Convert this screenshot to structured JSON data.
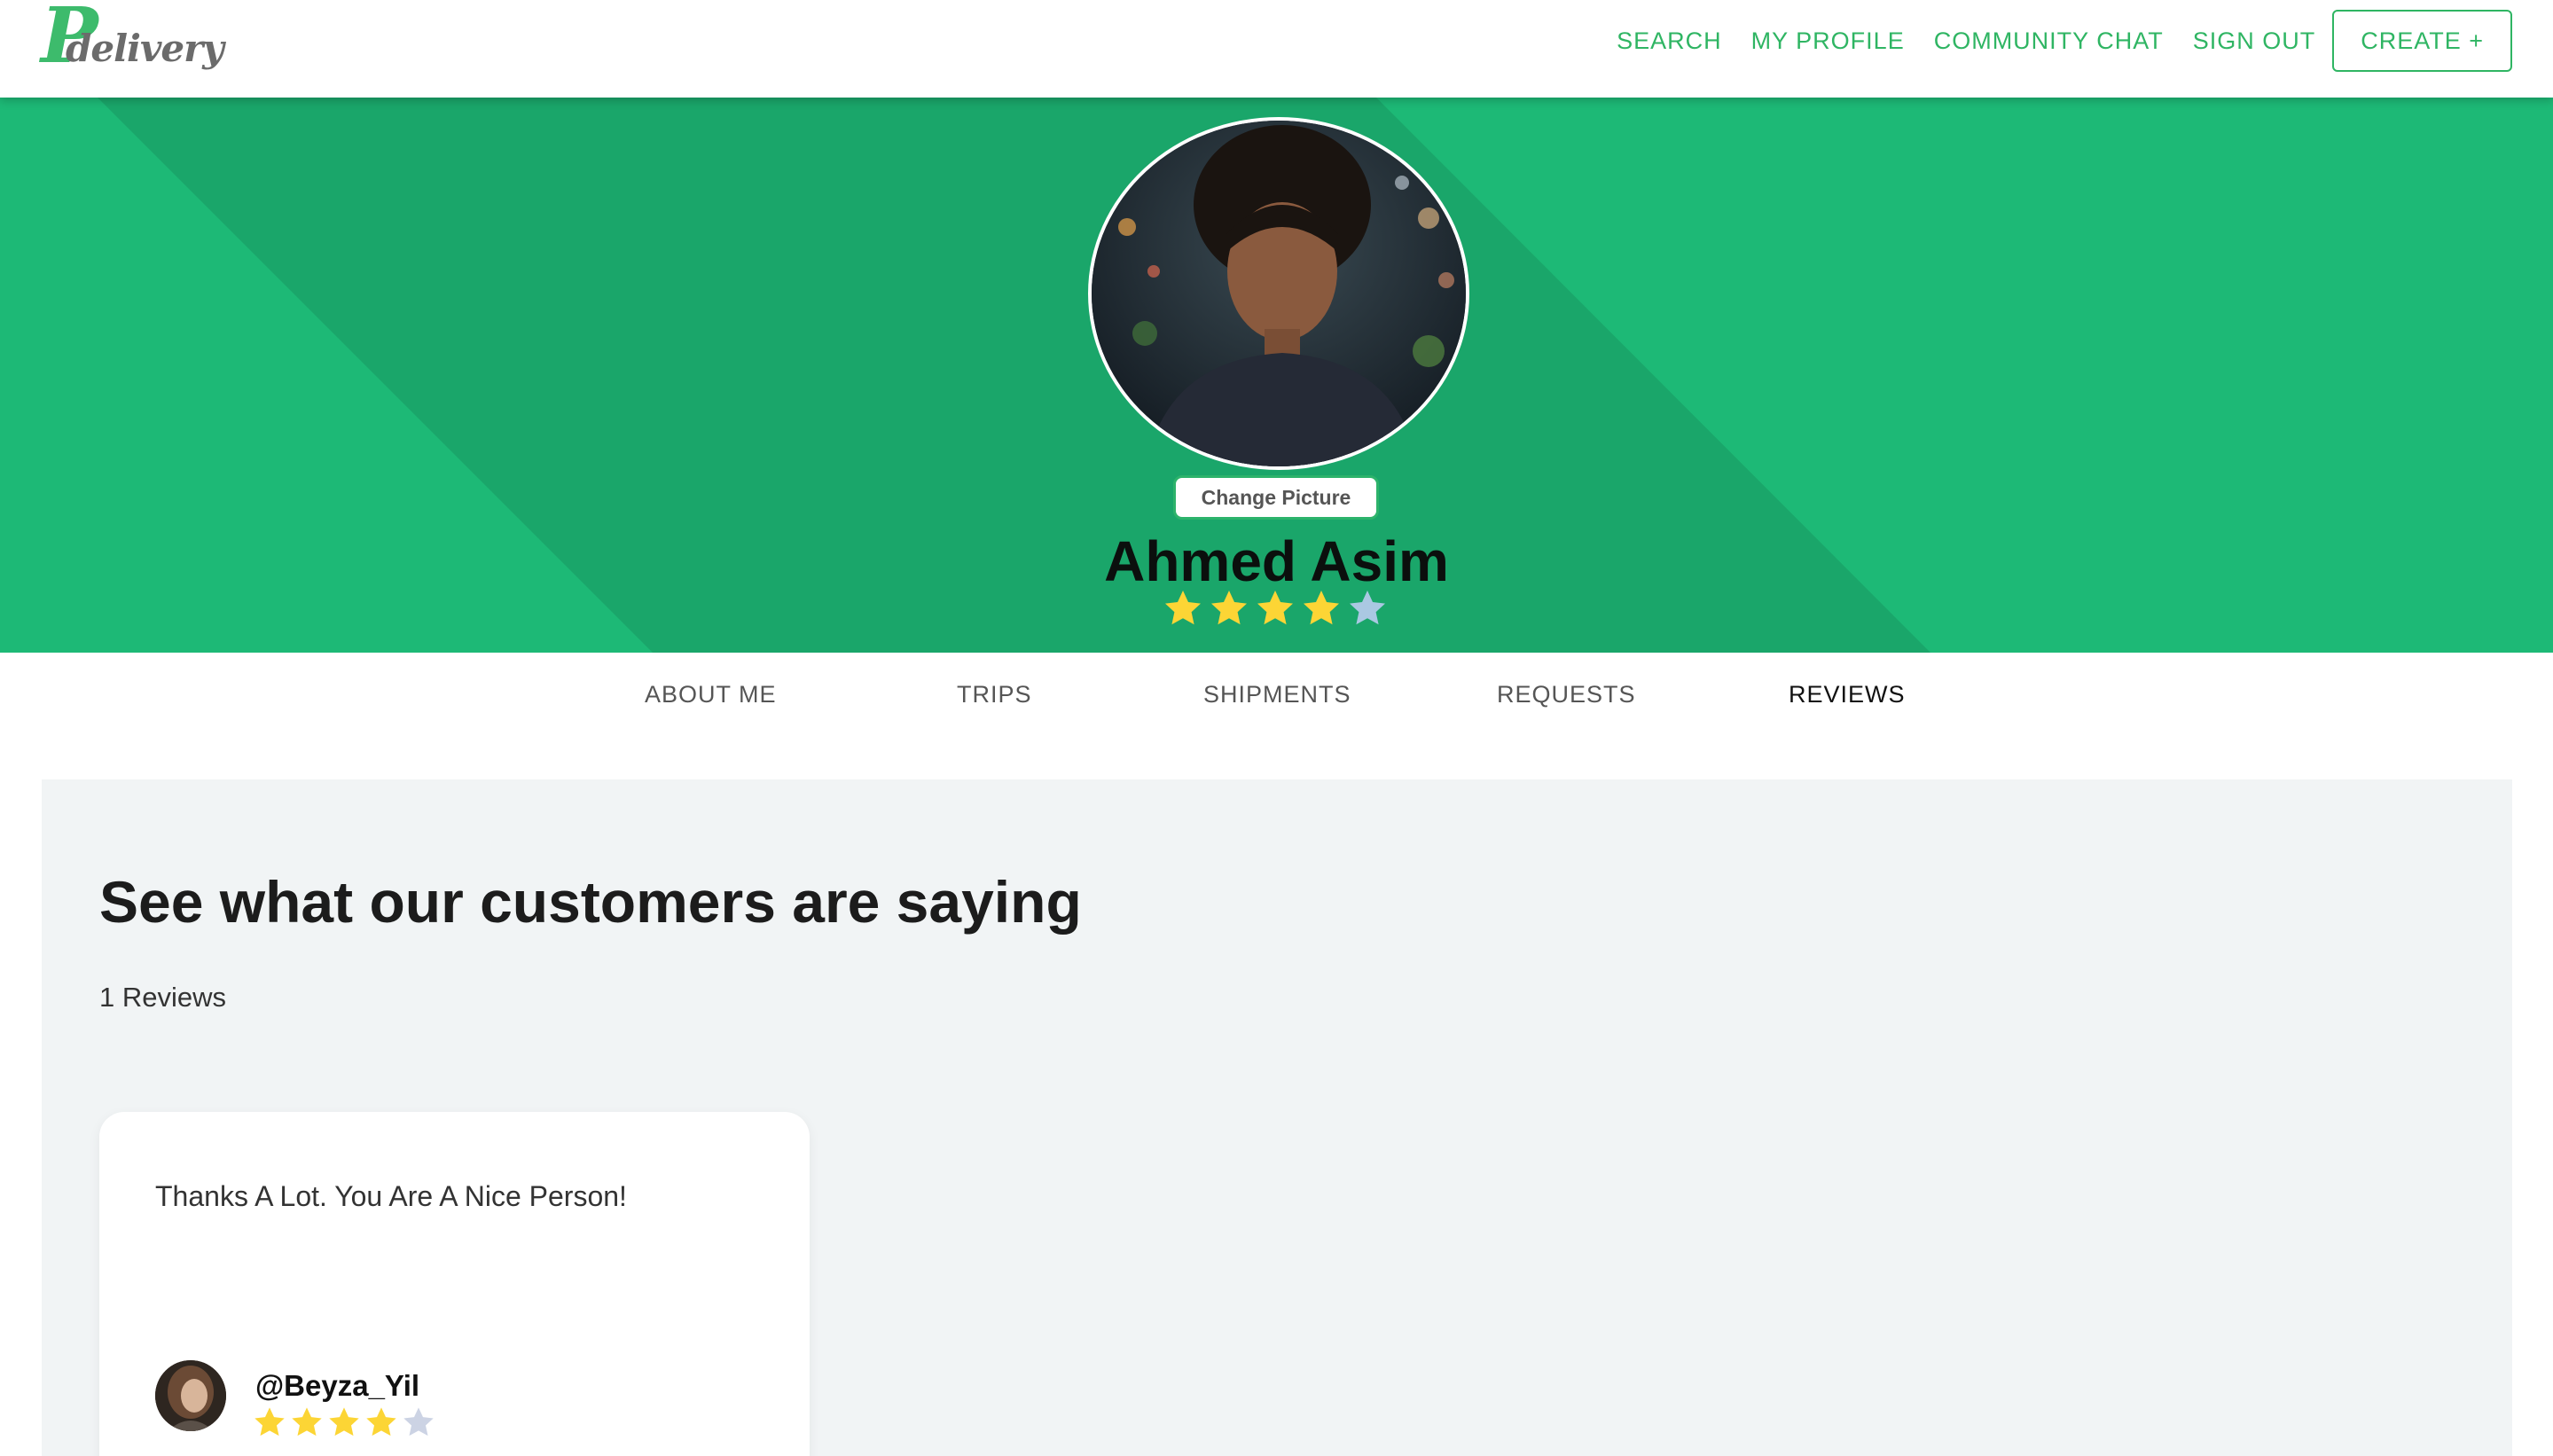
{
  "brand": {
    "logo_letter": "P",
    "logo_word": "delivery"
  },
  "nav": {
    "links": [
      "SEARCH",
      "MY PROFILE",
      "COMMUNITY CHAT",
      "SIGN OUT"
    ],
    "create_label": "CREATE +"
  },
  "profile": {
    "change_picture_label": "Change Picture",
    "name": "Ahmed Asim",
    "rating": 4,
    "rating_max": 5
  },
  "tabs": {
    "items": [
      "ABOUT ME",
      "TRIPS",
      "SHIPMENTS",
      "REQUESTS",
      "REVIEWS"
    ],
    "active": "REVIEWS"
  },
  "reviews": {
    "heading": "See what our customers are saying",
    "count_label": "1 Reviews",
    "items": [
      {
        "text": "Thanks A Lot. You Are A Nice Person!",
        "author": "@Beyza_Yil",
        "rating": 4,
        "rating_max": 5
      }
    ]
  },
  "colors": {
    "brand_green": "#2fb563",
    "hero_green": "#1db976",
    "hero_dark_band": "#1aa66a",
    "star_filled": "#fcd535",
    "star_empty_hero": "#aac8e2",
    "star_empty_card": "#ccd3e4",
    "panel_bg": "#f1f4f5"
  },
  "icons": {
    "star": "star-icon"
  }
}
